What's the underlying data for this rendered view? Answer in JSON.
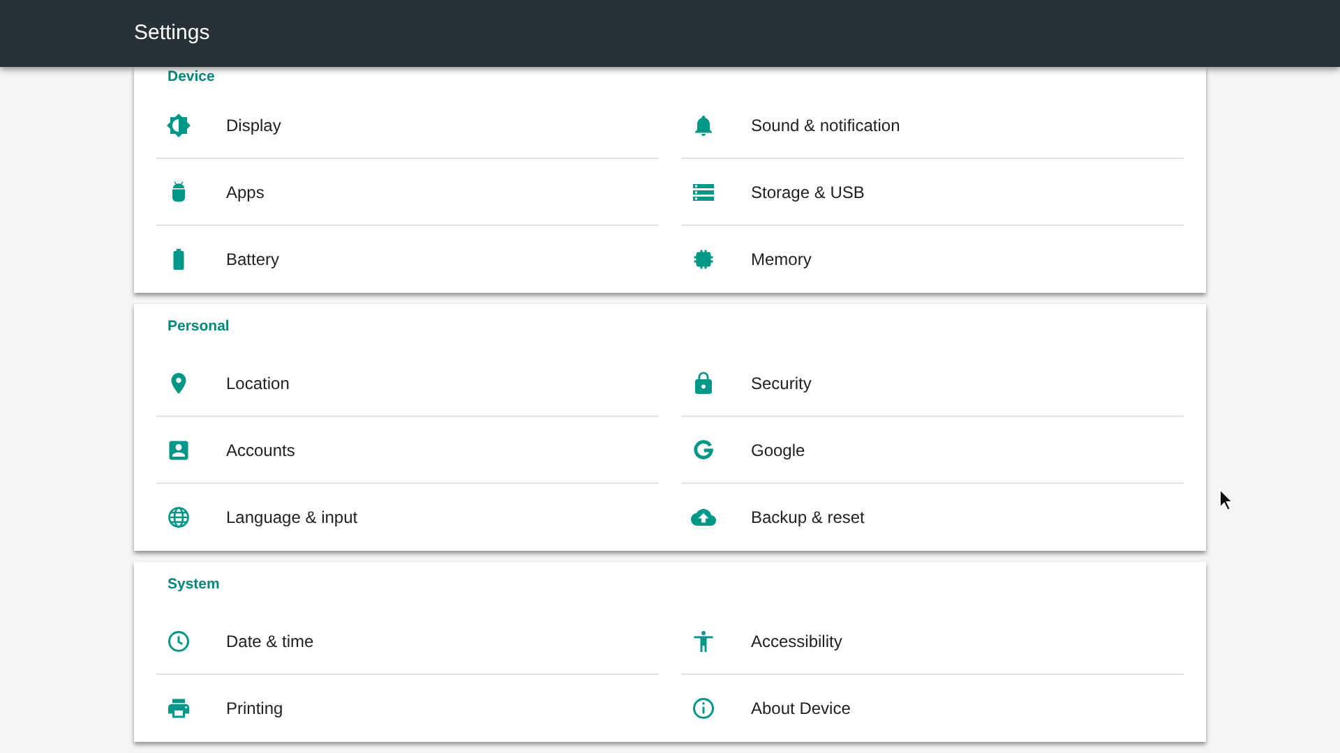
{
  "app_bar": {
    "title": "Settings"
  },
  "sections": [
    {
      "header": "Device",
      "items": [
        {
          "label": "Display"
        },
        {
          "label": "Sound & notification"
        },
        {
          "label": "Apps"
        },
        {
          "label": "Storage & USB"
        },
        {
          "label": "Battery"
        },
        {
          "label": "Memory"
        }
      ]
    },
    {
      "header": "Personal",
      "items": [
        {
          "label": "Location"
        },
        {
          "label": "Security"
        },
        {
          "label": "Accounts"
        },
        {
          "label": "Google"
        },
        {
          "label": "Language & input"
        },
        {
          "label": "Backup & reset"
        }
      ]
    },
    {
      "header": "System",
      "items": [
        {
          "label": "Date & time"
        },
        {
          "label": "Accessibility"
        },
        {
          "label": "Printing"
        },
        {
          "label": "About Device"
        }
      ]
    }
  ]
}
